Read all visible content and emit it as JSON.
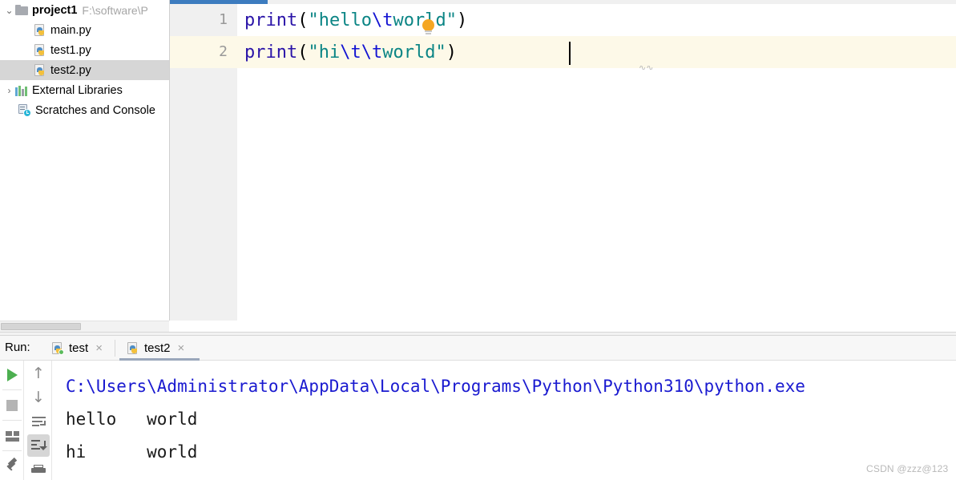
{
  "project_panel": {
    "root": {
      "name": "project1",
      "path": "F:\\software\\P",
      "icon": "folder-icon",
      "arrow": "⌄"
    },
    "files": [
      {
        "name": "main.py",
        "icon": "python-file-icon"
      },
      {
        "name": "test1.py",
        "icon": "python-file-icon"
      },
      {
        "name": "test2.py",
        "icon": "python-file-icon",
        "selected": true
      }
    ],
    "external_libraries": {
      "label": "External Libraries",
      "icon": "library-icon",
      "arrow": "›"
    },
    "scratches": {
      "label": "Scratches and Console",
      "icon": "scratches-clock-icon"
    }
  },
  "editor": {
    "lines": [
      {
        "number": "1",
        "tokens": [
          {
            "text": "print",
            "type": "function"
          },
          {
            "text": "(",
            "type": "paren"
          },
          {
            "text": "\"hello",
            "type": "string"
          },
          {
            "text": "\\t",
            "type": "escape"
          },
          {
            "text": "world\"",
            "type": "string"
          },
          {
            "text": ")",
            "type": "paren"
          }
        ]
      },
      {
        "number": "2",
        "tokens": [
          {
            "text": "print",
            "type": "function"
          },
          {
            "text": "(",
            "type": "paren"
          },
          {
            "text": "\"hi",
            "type": "string"
          },
          {
            "text": "\\t",
            "type": "escape"
          },
          {
            "text": "\\t",
            "type": "escape"
          },
          {
            "text": "world\"",
            "type": "string"
          },
          {
            "text": ")",
            "type": "paren"
          }
        ]
      }
    ],
    "intention_bulb": "lightbulb-icon",
    "caret_line": 2,
    "squiggle": "∿∿",
    "colors": {
      "function": "#2a14a8",
      "string": "#0b8585",
      "escape": "#1414d2",
      "paren": "#000000",
      "current_line_highlight": "#fdf9e8",
      "gutter_bg": "#f0f0f0",
      "tab_indicator": "#3d7cbf"
    }
  },
  "run_panel": {
    "label": "Run:",
    "tabs": [
      {
        "label": "test",
        "icon": "python-running-icon",
        "active": false,
        "close": "×"
      },
      {
        "label": "test2",
        "icon": "python-icon",
        "active": true,
        "close": "×"
      }
    ],
    "toolbar_left": [
      {
        "name": "rerun-button",
        "icon": "play-icon"
      },
      {
        "name": "stop-button",
        "icon": "stop-icon"
      },
      {
        "name": "layout-button",
        "icon": "layout-icon"
      },
      {
        "name": "pin-button",
        "icon": "pin-icon"
      }
    ],
    "toolbar_right": [
      {
        "name": "up-button",
        "icon": "arrow-up-icon",
        "glyph": "↑"
      },
      {
        "name": "down-button",
        "icon": "arrow-down-icon",
        "glyph": "↓"
      },
      {
        "name": "soft-wrap-button",
        "icon": "soft-wrap-icon"
      },
      {
        "name": "scroll-to-end-button",
        "icon": "scroll-to-end-icon",
        "active": true
      },
      {
        "name": "print-button",
        "icon": "print-icon"
      }
    ],
    "console": {
      "command": "C:\\Users\\Administrator\\AppData\\Local\\Programs\\Python\\Python310\\python.exe",
      "output": [
        "hello   world",
        "hi      world"
      ],
      "command_color": "#1a1ad0",
      "output_color": "#1a1a1a"
    }
  },
  "watermark": "CSDN @zzz@123"
}
